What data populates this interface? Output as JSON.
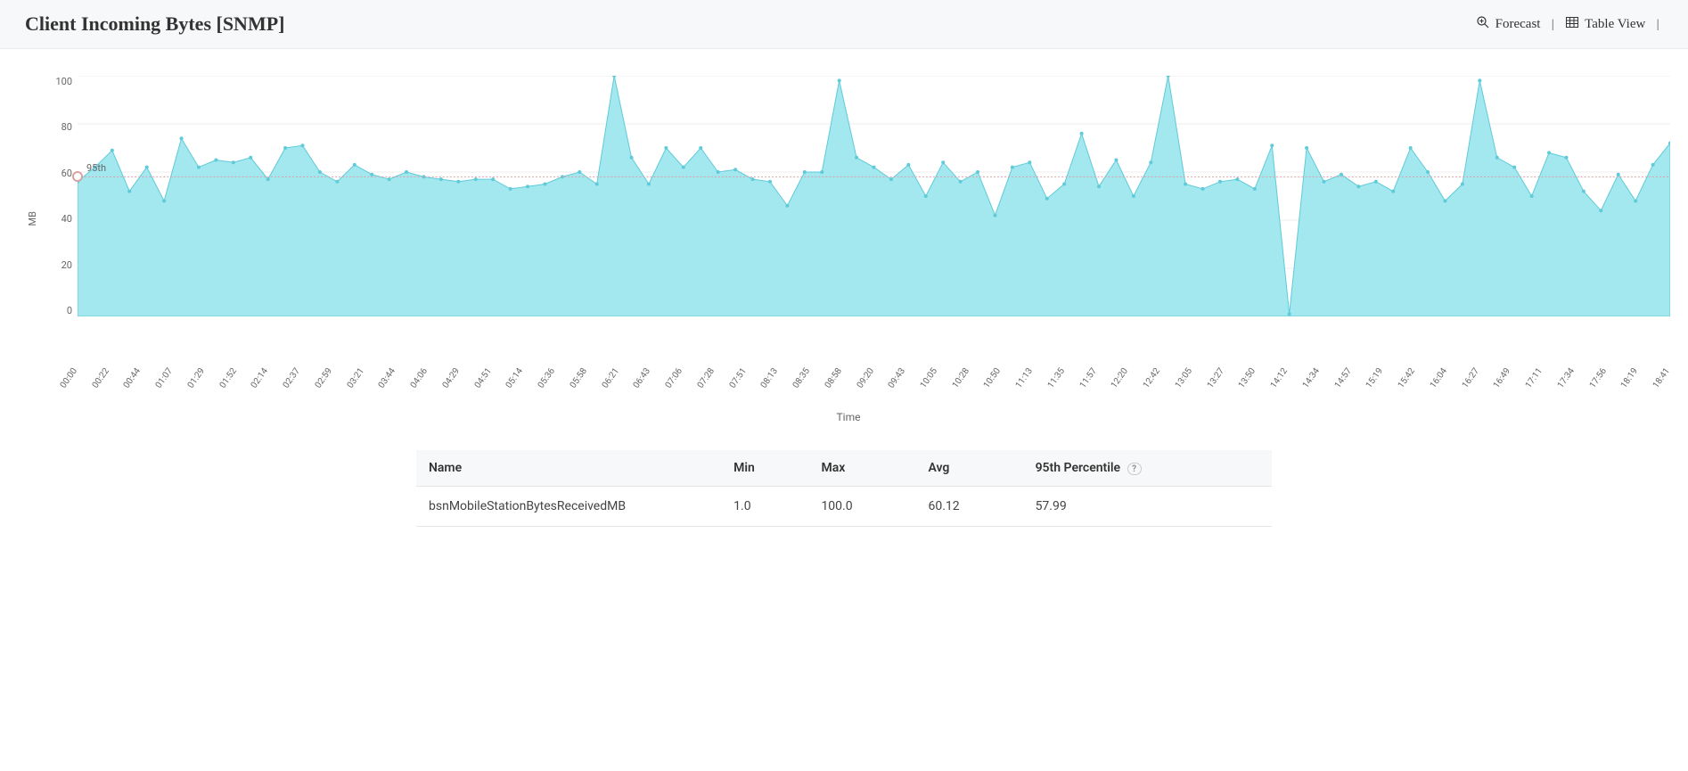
{
  "header": {
    "title": "Client Incoming Bytes [SNMP]",
    "forecast_label": "Forecast",
    "table_view_label": "Table View"
  },
  "chart_data": {
    "type": "area",
    "ylabel": "MB",
    "xlabel": "Time",
    "ylim": [
      0,
      100
    ],
    "yticks": [
      0,
      20,
      40,
      60,
      80,
      100
    ],
    "percentile_label": "95th",
    "percentile_value": 57.99,
    "categories": [
      "00:00",
      "00:22",
      "00:44",
      "01:07",
      "01:29",
      "01:52",
      "02:14",
      "02:37",
      "02:59",
      "03:21",
      "03:44",
      "04:06",
      "04:29",
      "04:51",
      "05:14",
      "05:36",
      "05:58",
      "06:21",
      "06:43",
      "07:06",
      "07:28",
      "07:51",
      "08:13",
      "08:35",
      "08:58",
      "09:20",
      "09:43",
      "10:05",
      "10:28",
      "10:50",
      "11:13",
      "11:35",
      "11:57",
      "12:20",
      "12:42",
      "13:05",
      "13:27",
      "13:50",
      "14:12",
      "14:34",
      "14:57",
      "15:19",
      "15:42",
      "16:04",
      "16:27",
      "16:49",
      "17:11",
      "17:34",
      "17:56",
      "18:19",
      "18:41"
    ],
    "series": [
      {
        "name": "bsnMobileStationBytesReceivedMB",
        "values": [
          56,
          62,
          69,
          52,
          62,
          48,
          74,
          62,
          65,
          64,
          66,
          57,
          70,
          71,
          60,
          56,
          63,
          59,
          57,
          60,
          58,
          57,
          56,
          57,
          57,
          53,
          54,
          55,
          58,
          60,
          55,
          100,
          66,
          55,
          70,
          62,
          70,
          60,
          61,
          57,
          56,
          46,
          60,
          60,
          98,
          66,
          62,
          57,
          63,
          50,
          64,
          56,
          60,
          42,
          62,
          64,
          49,
          55,
          76,
          54,
          65,
          50,
          64,
          100,
          55,
          53,
          56,
          57,
          53,
          71,
          1,
          70,
          56,
          59,
          54,
          56,
          52,
          70,
          60,
          48,
          55,
          98,
          66,
          62,
          50,
          68,
          66,
          52,
          44,
          59,
          48,
          63,
          72
        ]
      }
    ]
  },
  "stats": {
    "columns": [
      "Name",
      "Min",
      "Max",
      "Avg",
      "95th Percentile"
    ],
    "rows": [
      {
        "name": "bsnMobileStationBytesReceivedMB",
        "min": "1.0",
        "max": "100.0",
        "avg": "60.12",
        "p95": "57.99"
      }
    ]
  }
}
